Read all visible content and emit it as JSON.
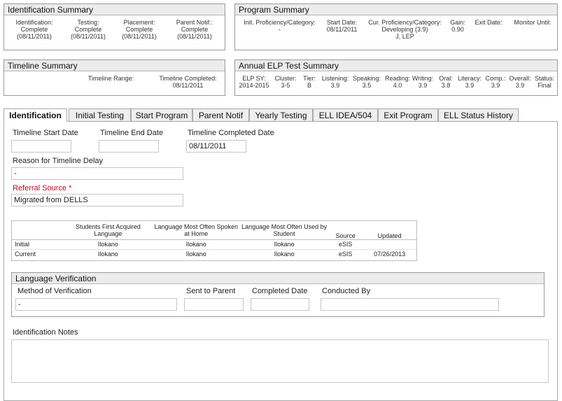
{
  "identification_summary": {
    "title": "Identification Summary",
    "columns": [
      {
        "label1": "Identification:",
        "label2": "Complete",
        "label3": "(08/11/2011)"
      },
      {
        "label1": "Testing:",
        "label2": "Complete",
        "label3": "(08/11/2011)"
      },
      {
        "label1": "Placement:",
        "label2": "Complete",
        "label3": "(08/11/2011)"
      },
      {
        "label1": "Parent Notif.:",
        "label2": "Complete",
        "label3": "(08/11/2011)"
      }
    ]
  },
  "program_summary": {
    "title": "Program Summary",
    "init_label": "Init. Proficiency/Category:",
    "init_value": "-",
    "start_label": "Start Date:",
    "start_value": "08/11/2011",
    "cur_label": "Cur. Proficiency/Category:",
    "cur_value1": "Developing (3.9)",
    "cur_value2": "J, LEP",
    "gain_label": "Gain:",
    "gain_value": "0.90",
    "exit_label": "Exit Date:",
    "monitor_label": "Monitor Until:"
  },
  "timeline_summary": {
    "title": "Timeline Summary",
    "range_label": "Timeline Range:",
    "completed_label": "Timeline Completed:",
    "completed_value": "08/11/2011"
  },
  "elp_summary": {
    "title": "Annual ELP Test Summary",
    "columns": [
      {
        "label": "ELP SY:",
        "value": "2014-2015"
      },
      {
        "label": "Cluster:",
        "value": "3-5"
      },
      {
        "label": "Tier:",
        "value": "B"
      },
      {
        "label": "Listening:",
        "value": "3.9"
      },
      {
        "label": "Speaking:",
        "value": "3.5"
      },
      {
        "label": "Reading:",
        "value": "4.0"
      },
      {
        "label": "Writing:",
        "value": "3.9"
      },
      {
        "label": "Oral:",
        "value": "3.8"
      },
      {
        "label": "Literacy:",
        "value": "3.9"
      },
      {
        "label": "Comp.:",
        "value": "3.9"
      },
      {
        "label": "Overall:",
        "value": "3.9"
      },
      {
        "label": "Status:",
        "value": "Final"
      }
    ]
  },
  "tabs": [
    {
      "label": "Identification"
    },
    {
      "label": "Initial Testing"
    },
    {
      "label": "Start Program"
    },
    {
      "label": "Parent Notif"
    },
    {
      "label": "Yearly Testing"
    },
    {
      "label": "ELL IDEA/504"
    },
    {
      "label": "Exit Program"
    },
    {
      "label": "ELL Status History"
    }
  ],
  "form": {
    "start_label": "Timeline Start Date",
    "start_value": "",
    "end_label": "Timeline End Date",
    "end_value": "",
    "completed_label": "Timeline Completed Date",
    "completed_value": "08/11/2011",
    "delay_label": "Reason for Timeline Delay",
    "delay_value": "-",
    "referral_label": "Referral Source *",
    "referral_value": "Migrated from DELLS"
  },
  "language_table": {
    "headers": [
      "",
      "Students First Acquired Language",
      "Language Most Often Spoken at Home",
      "Language Most Often Used by Student",
      "Source",
      "Updated"
    ],
    "rows": [
      [
        "Initial",
        "Ilokano",
        "Ilokano",
        "Ilokano",
        "eSIS",
        ""
      ],
      [
        "Current",
        "Ilokano",
        "Ilokano",
        "Ilokano",
        "eSIS",
        "07/26/2013"
      ]
    ]
  },
  "language_verification": {
    "title": "Language Verification",
    "method_label": "Method of Verification",
    "method_value": "-",
    "sent_label": "Sent to Parent",
    "sent_value": "",
    "completed_label": "Completed Date",
    "completed_value": "",
    "conducted_label": "Conducted By",
    "conducted_value": ""
  },
  "notes": {
    "label": "Identification Notes",
    "value": ""
  }
}
